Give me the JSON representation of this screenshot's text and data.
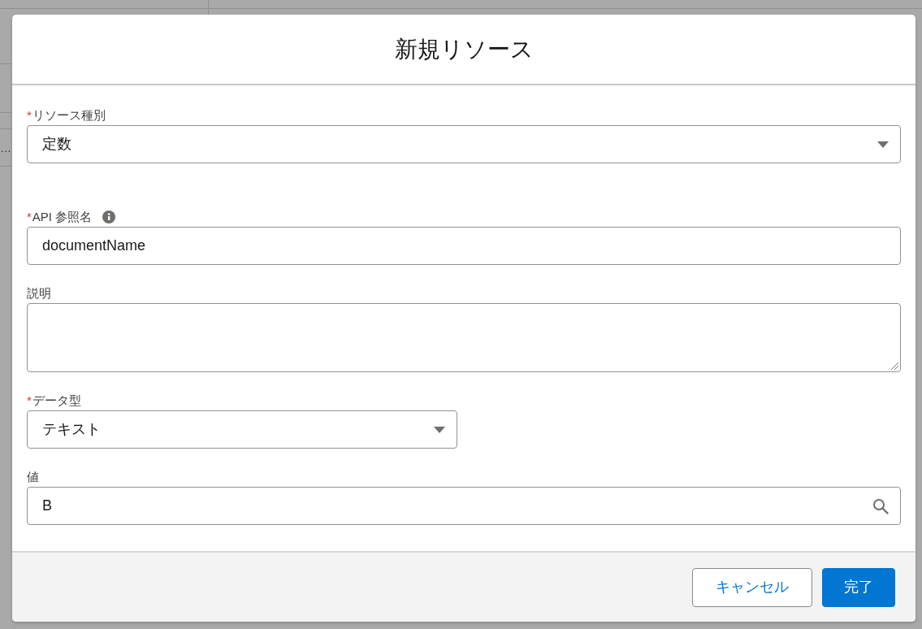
{
  "background": {
    "ellipsis": "…"
  },
  "dialog": {
    "title": "新規リソース"
  },
  "fields": [
    {
      "kind": "select",
      "label": "リソース種別",
      "required_mark": "*",
      "value": "定数"
    },
    {
      "kind": "text",
      "label": "API 参照名",
      "required_mark": "*",
      "info": true,
      "value": "documentName"
    },
    {
      "kind": "textarea",
      "label": "説明"
    },
    {
      "kind": "select",
      "label": "データ型",
      "required_mark": "*",
      "value": "テキスト"
    },
    {
      "kind": "lookup",
      "label": "値",
      "value": "B"
    }
  ],
  "buttons": [
    {
      "label": "キャンセル",
      "kind": "neutral"
    },
    {
      "label": "完了",
      "kind": "brand"
    }
  ]
}
